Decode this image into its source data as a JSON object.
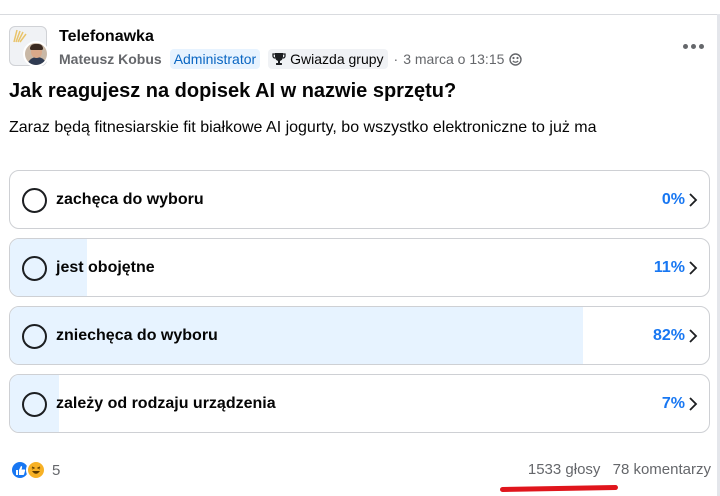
{
  "post": {
    "group_name": "Telefonawka",
    "author": "Mateusz Kobus",
    "badge_admin": "Administrator",
    "badge_star": "Gwiazda grupy",
    "separator": "·",
    "date": "3 marca o 13:15",
    "question": "Jak reagujesz na dopisek AI w nazwie sprzętu?",
    "description": "Zaraz będą fitnesiarskie fit białkowe AI jogurty, bo wszystko elektroniczne to już ma"
  },
  "poll": {
    "options": [
      {
        "label": "zachęca do wyboru",
        "percent_text": "0%",
        "percent": 0
      },
      {
        "label": "jest obojętne",
        "percent_text": "11%",
        "percent": 11
      },
      {
        "label": "zniechęca do wyboru",
        "percent_text": "82%",
        "percent": 82
      },
      {
        "label": "zależy od rodzaju urządzenia",
        "percent_text": "7%",
        "percent": 7
      }
    ]
  },
  "footer": {
    "reaction_count": "5",
    "votes": "1533 głosy",
    "comments": "78 komentarzy"
  },
  "colors": {
    "accent": "#1877f2",
    "fill": "#e7f3ff",
    "annotation": "#e0151c"
  },
  "icons": [
    "more-options-icon",
    "trophy-icon",
    "globe-icon",
    "radio-icon",
    "chevron-right-icon",
    "like-icon",
    "haha-icon"
  ]
}
